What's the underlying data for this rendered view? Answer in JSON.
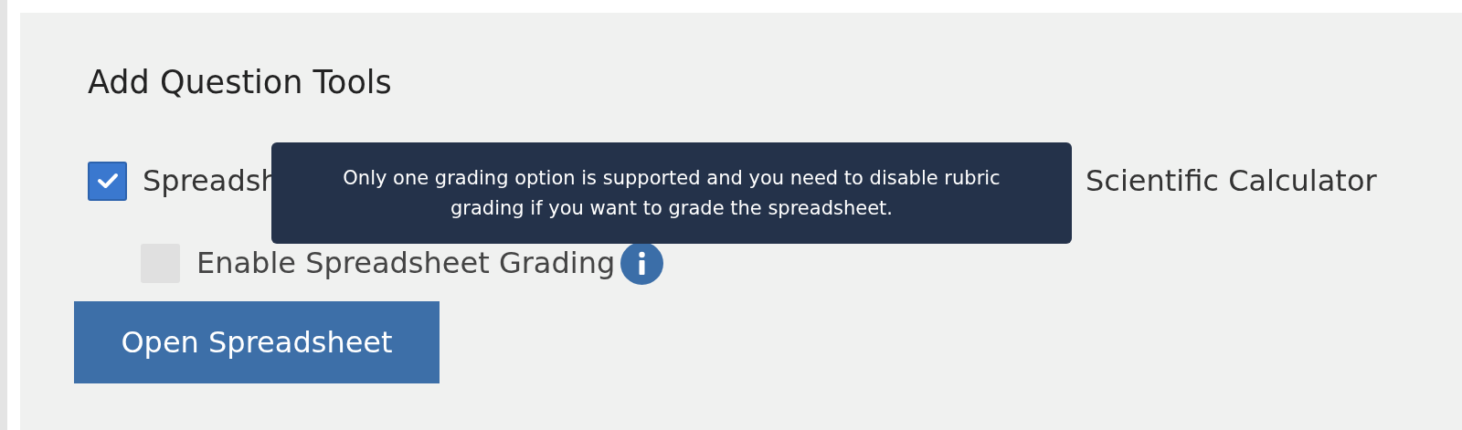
{
  "section": {
    "title": "Add Question Tools"
  },
  "tools": [
    {
      "label": "Spreadsh",
      "checked": true
    },
    {
      "label": "Scientific Calculator"
    }
  ],
  "grading_option": {
    "label": "Enable Spreadsheet Grading",
    "checked": false,
    "disabled": true
  },
  "tooltip": {
    "text": "Only one grading option is supported and you need to disable rubric grading if you want to grade the spreadsheet."
  },
  "button": {
    "label": "Open Spreadsheet"
  }
}
